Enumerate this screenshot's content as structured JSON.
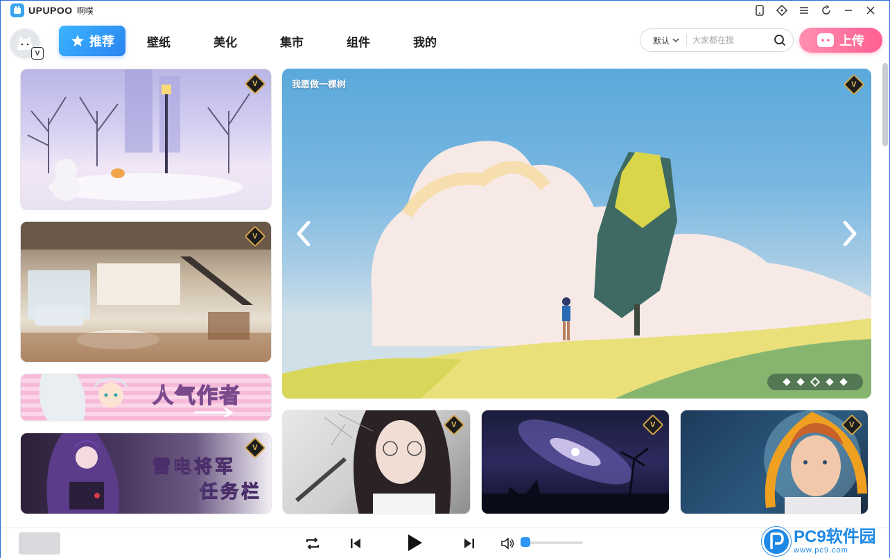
{
  "app": {
    "name": "UPUPOO",
    "subtitle": "啊噗"
  },
  "window_controls": [
    "tablet-icon",
    "diamond-icon",
    "menu-icon",
    "refresh-icon",
    "minimize-icon",
    "close-icon"
  ],
  "nav": {
    "tabs": [
      {
        "label": "推荐",
        "active": true
      },
      {
        "label": "壁纸",
        "active": false
      },
      {
        "label": "美化",
        "active": false
      },
      {
        "label": "集市",
        "active": false
      },
      {
        "label": "组件",
        "active": false
      },
      {
        "label": "我的",
        "active": false
      }
    ],
    "avatar_badge": "V"
  },
  "search": {
    "sort": "默认",
    "placeholder": "大家都在搜"
  },
  "upload": {
    "label": "上传"
  },
  "banner": {
    "title": "我愿做一棵树",
    "dot_count": 5,
    "active_dot": 3,
    "badge": "V"
  },
  "left_cards": [
    {
      "name": "winter-park-card",
      "badge": "V",
      "text": ""
    },
    {
      "name": "loft-interior-card",
      "badge": "V",
      "text": ""
    },
    {
      "name": "popular-author-card",
      "badge": "",
      "text": "人气作者"
    },
    {
      "name": "raiden-taskbar-card",
      "badge": "V",
      "text_line1": "雷电将军",
      "text_line2": "任务栏"
    }
  ],
  "bottom_cards": [
    {
      "name": "girl-glasses-card",
      "badge": "V"
    },
    {
      "name": "galaxy-card",
      "badge": "V"
    },
    {
      "name": "astronaut-girl-card",
      "badge": "V"
    }
  ],
  "watermark": {
    "big": "PC9软件园",
    "small": "www.pc9.com"
  },
  "colors": {
    "accent": "#2a83f0",
    "upload": "#ff5f92",
    "vip_gold": "#d6a648"
  }
}
